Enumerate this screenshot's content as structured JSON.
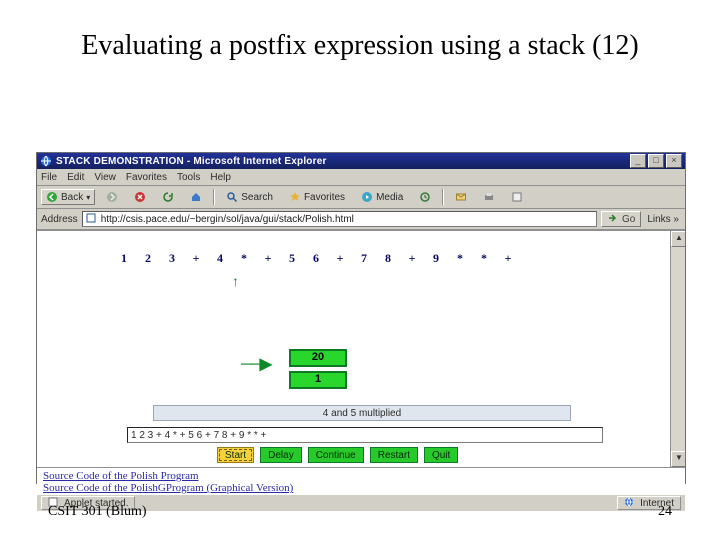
{
  "slide": {
    "title": "Evaluating a postfix expression using a stack (12)",
    "footer_left": "CSIT 301 (Blum)",
    "footer_right": "24"
  },
  "browser": {
    "window_title": "STACK DEMONSTRATION - Microsoft Internet Explorer",
    "menus": [
      "File",
      "Edit",
      "View",
      "Favorites",
      "Tools",
      "Help"
    ],
    "toolbar": {
      "back": "Back",
      "search": "Search",
      "favorites": "Favorites",
      "media": "Media"
    },
    "address_label": "Address",
    "address_value": "http://csis.pace.edu/~bergin/sol/java/gui/stack/Polish.html",
    "go_label": "Go",
    "links_label": "Links »",
    "status_left": "Applet started.",
    "status_right": "Internet"
  },
  "applet": {
    "tokens": [
      "1",
      "2",
      "3",
      "+",
      "4",
      "*",
      "+",
      "5",
      "6",
      "+",
      "7",
      "8",
      "+",
      "9",
      "*",
      "*",
      "+"
    ],
    "pointer_index": 5,
    "stack_values": [
      "20",
      "1"
    ],
    "message": "4 and 5 multiplied",
    "input_expression": "1 2 3 + 4 * + 5 6 + 7 8 + 9 * * +",
    "buttons": {
      "start": "Start",
      "delay": "Delay",
      "continue": "Continue",
      "restart": "Restart",
      "quit": "Quit"
    },
    "links": [
      "Source Code of the Polish Program",
      "Source Code of the PolishGProgram (Graphical Version)"
    ]
  }
}
